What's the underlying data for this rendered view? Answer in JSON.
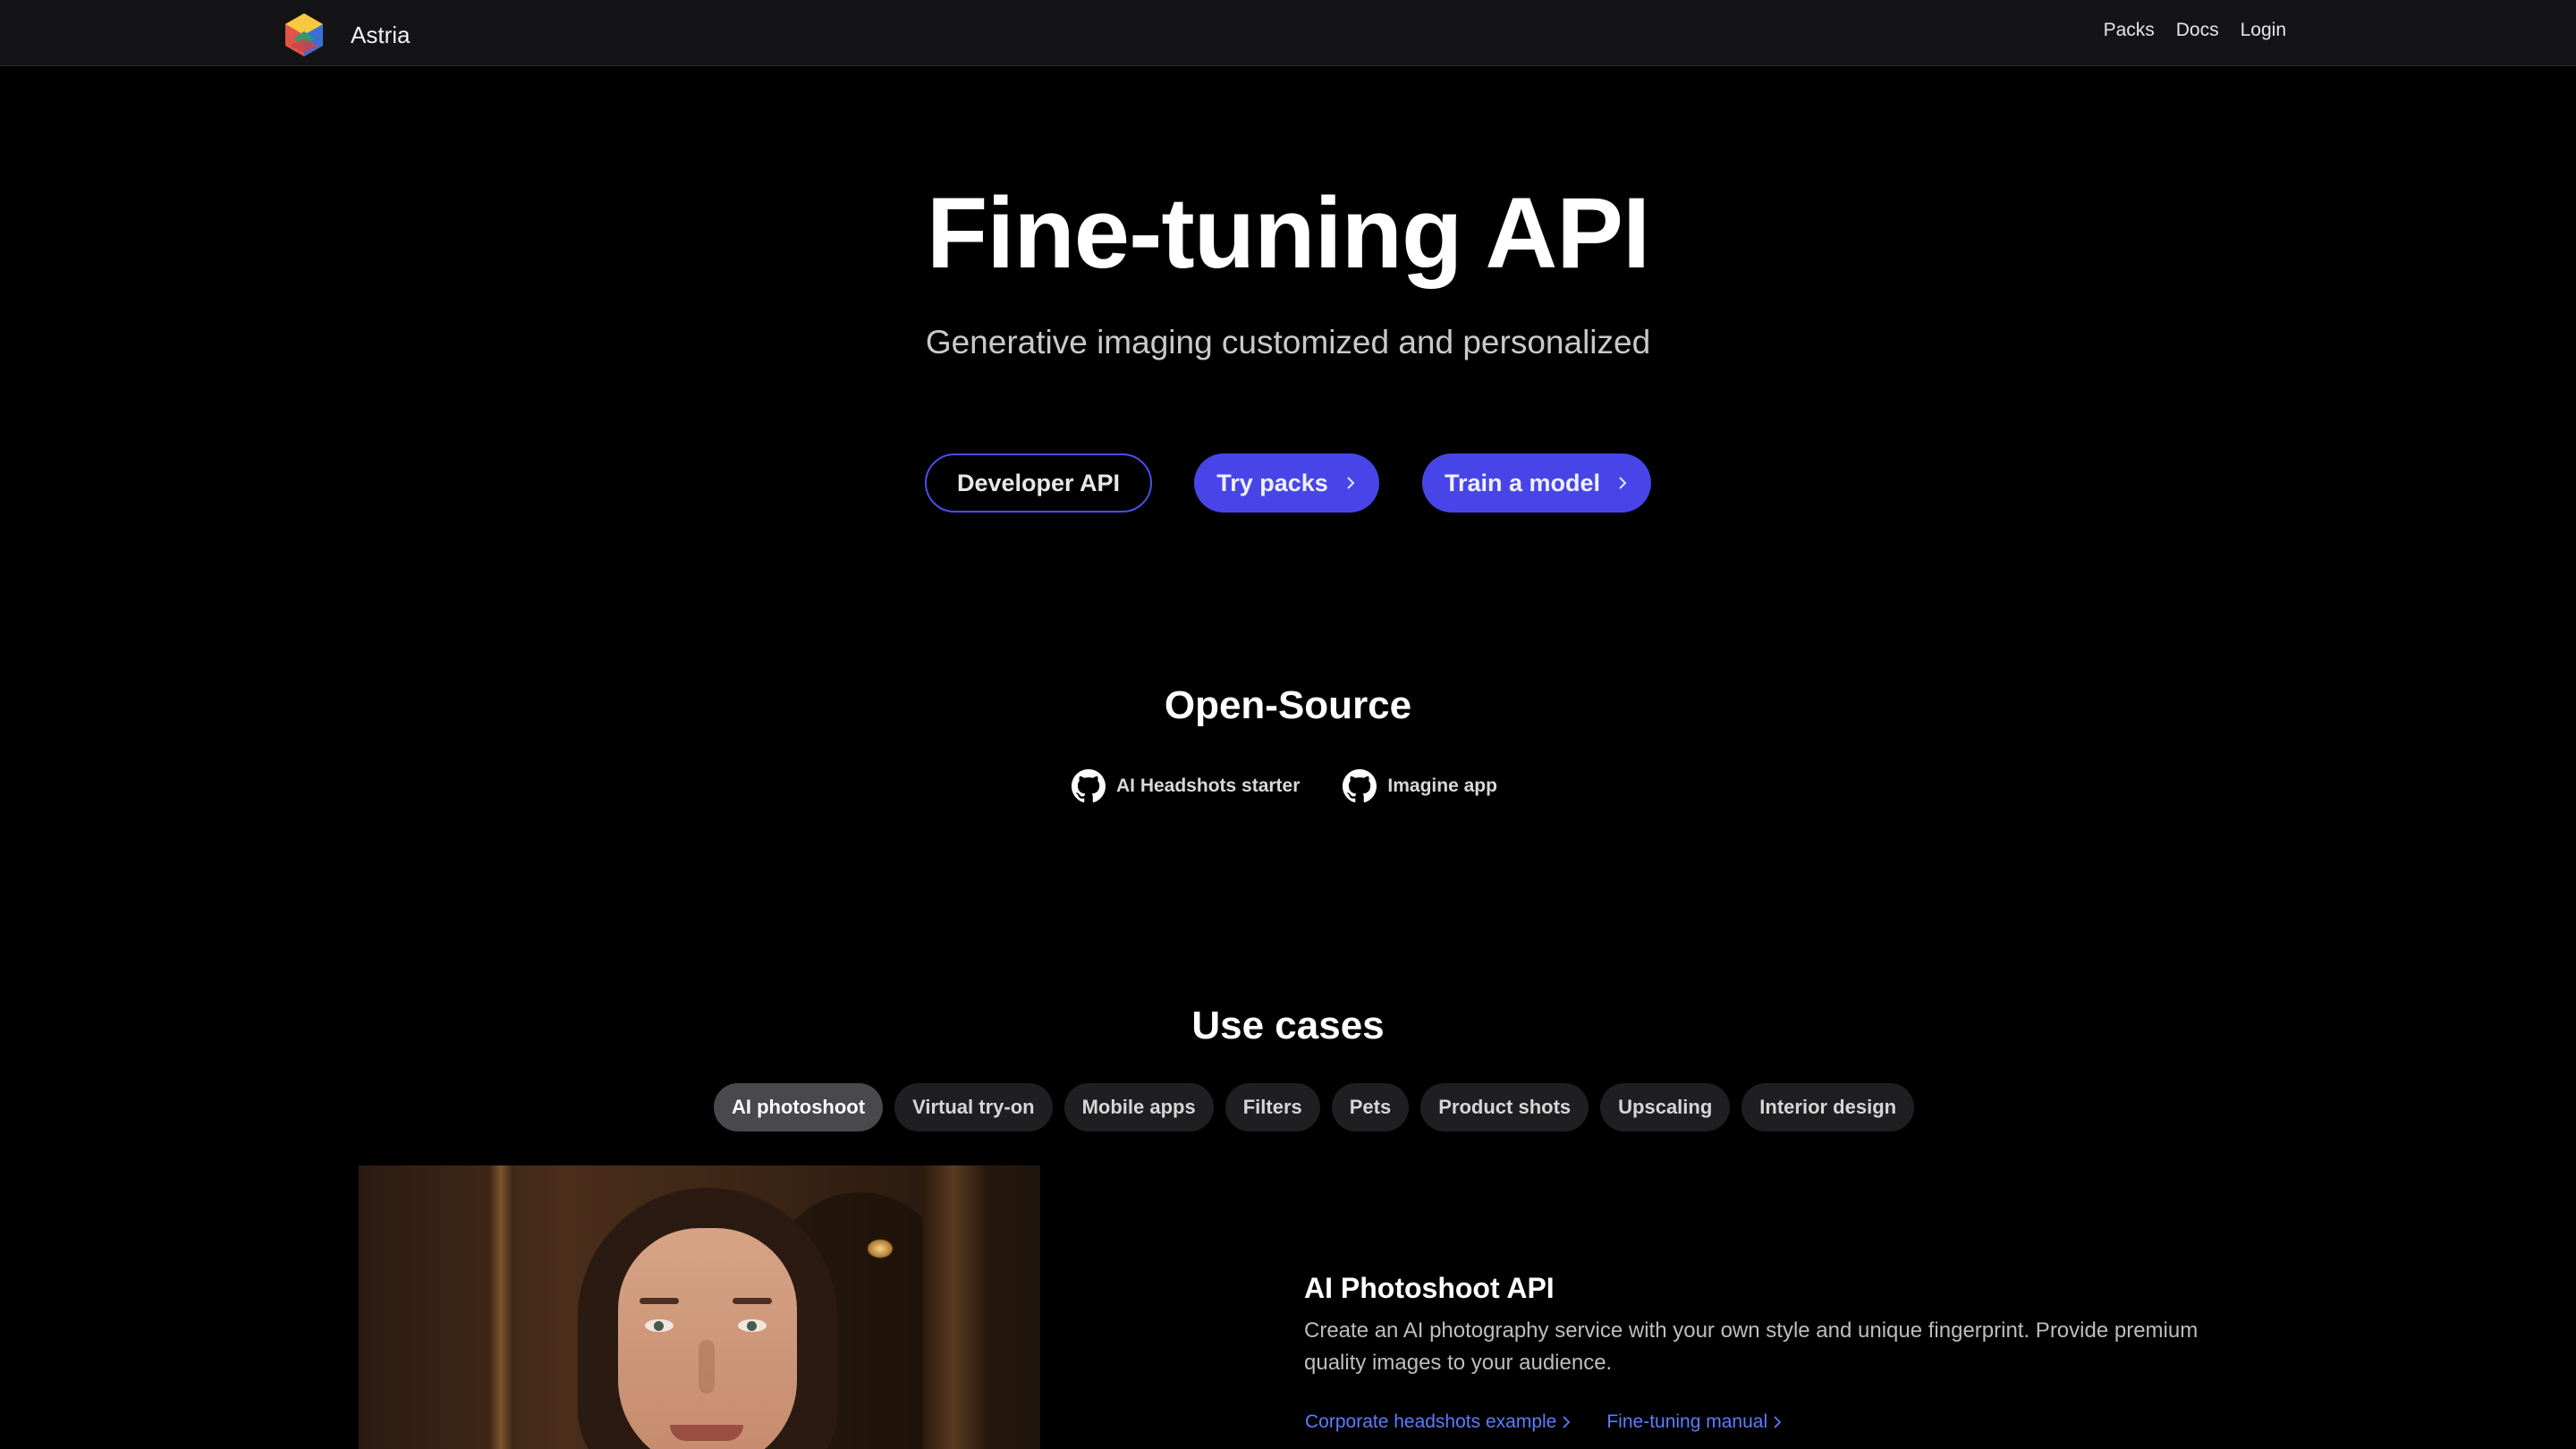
{
  "header": {
    "brand": "Astria",
    "nav": [
      "Packs",
      "Docs",
      "Login"
    ]
  },
  "hero": {
    "title": "Fine-tuning API",
    "subtitle": "Generative imaging customized and personalized",
    "buttons": {
      "developer_api": "Developer API",
      "try_packs": "Try packs",
      "train_model": "Train a model"
    }
  },
  "open_source": {
    "title": "Open-Source",
    "links": [
      {
        "label": "AI Headshots starter",
        "icon": "github-icon"
      },
      {
        "label": "Imagine app",
        "icon": "github-icon"
      }
    ]
  },
  "use_cases": {
    "title": "Use cases",
    "tabs": [
      "AI photoshoot",
      "Virtual try-on",
      "Mobile apps",
      "Filters",
      "Pets",
      "Product shots",
      "Upscaling",
      "Interior design"
    ],
    "active_tab": "AI photoshoot",
    "panel": {
      "heading": "AI Photoshoot API",
      "description": "Create an AI photography service with your own style and unique fingerprint. Provide premium quality images to your audience.",
      "links": [
        "Corporate headshots example",
        "Fine-tuning manual"
      ]
    }
  },
  "colors": {
    "accent": "#4845e8",
    "link": "#5c7cff",
    "background": "#000000",
    "header_bg": "#141416"
  }
}
